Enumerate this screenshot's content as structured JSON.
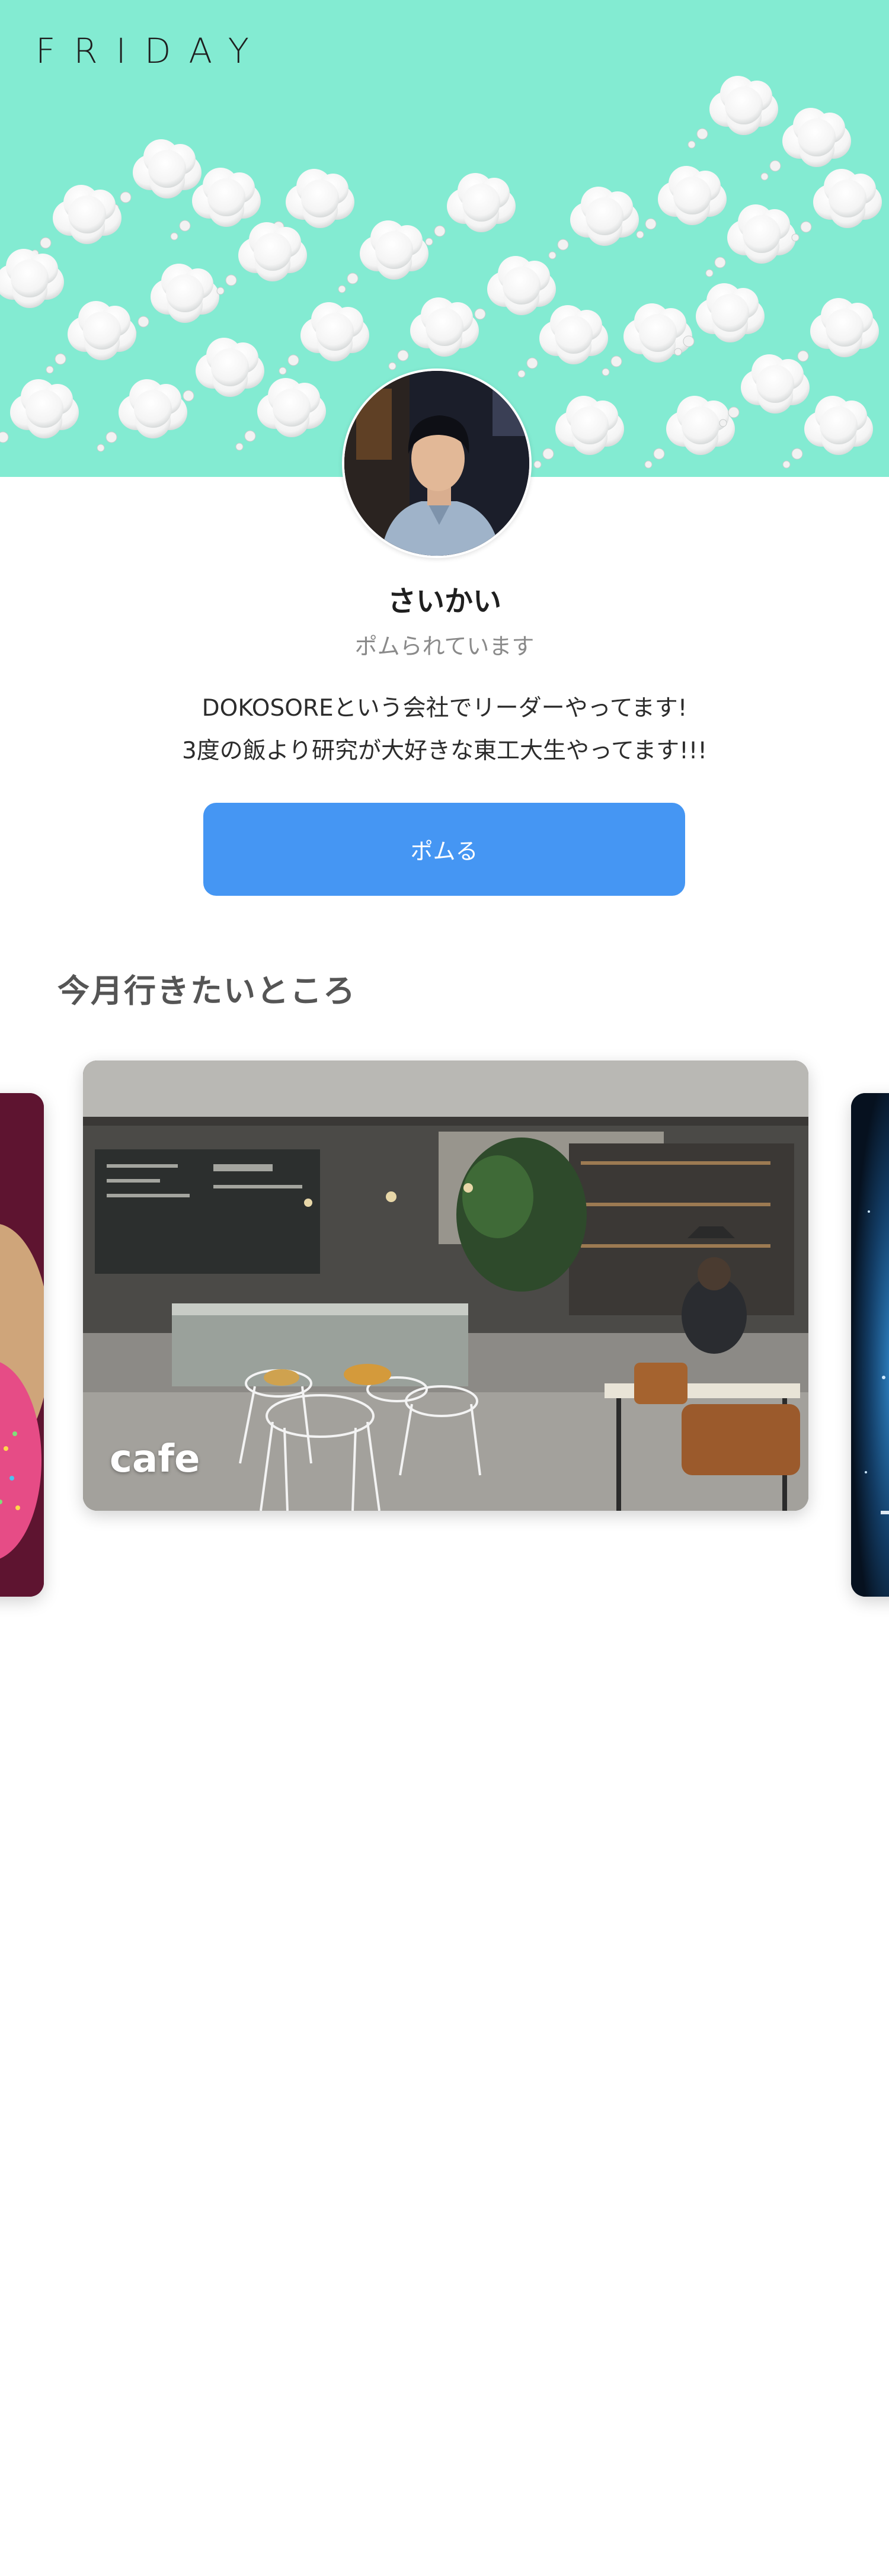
{
  "header": {
    "logo": "FRIDAY",
    "background_color": "#83ebd2"
  },
  "profile": {
    "avatar_icon": "person-photo",
    "name": "さいかい",
    "status": "ポムられています",
    "bio_line1": "DOKOSOREという会社でリーダーやってます!",
    "bio_line2": "3度の飯より研究が大好きな東工大生やってます!!!"
  },
  "action": {
    "pomu_label": "ポムる",
    "button_color": "#4596f3"
  },
  "section": {
    "title": "今月行きたいところ"
  },
  "carousel": {
    "cards": [
      {
        "label": "",
        "image": "donut-sprinkles-photo"
      },
      {
        "label": "cafe",
        "image": "cafe-interior-photo"
      },
      {
        "label": "",
        "image": "night-sky-photo"
      }
    ]
  }
}
